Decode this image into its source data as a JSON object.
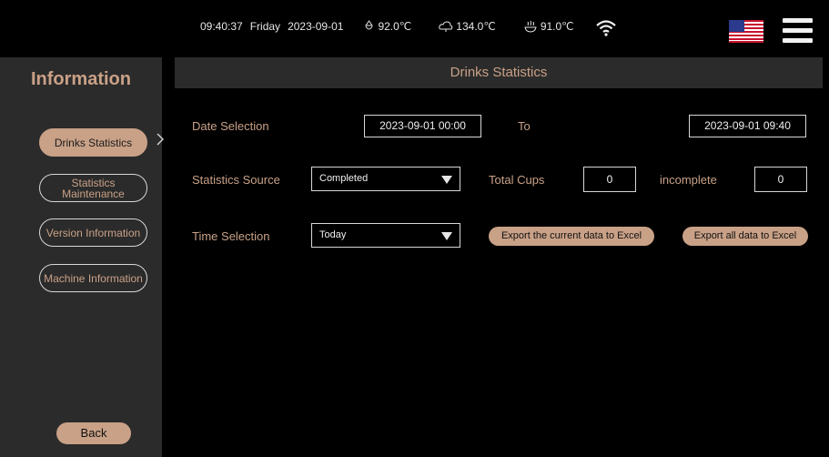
{
  "status_bar": {
    "time": "09:40:37",
    "weekday": "Friday",
    "date": "2023-09-01",
    "temps": [
      {
        "icon": "boiler-icon",
        "value": "92.0℃"
      },
      {
        "icon": "steam-icon",
        "value": "134.0℃"
      },
      {
        "icon": "cup-heater-icon",
        "value": "91.0℃"
      }
    ]
  },
  "sidebar": {
    "title": "Information",
    "items": [
      {
        "label": "Drinks Statistics",
        "active": true
      },
      {
        "label": "Statistics Maintenance",
        "active": false
      },
      {
        "label": "Version Information",
        "active": false
      },
      {
        "label": "Machine Information",
        "active": false
      }
    ],
    "back_label": "Back"
  },
  "main": {
    "header": "Drinks Statistics",
    "date_selection_label": "Date Selection",
    "date_from": "2023-09-01 00:00",
    "to_label": "To",
    "date_to": "2023-09-01 09:40",
    "statistics_source_label": "Statistics Source",
    "statistics_source_value": "Completed",
    "total_cups_label": "Total Cups",
    "total_cups_value": "0",
    "incomplete_label": "incomplete",
    "incomplete_value": "0",
    "time_selection_label": "Time Selection",
    "time_selection_value": "Today",
    "export_current_label": "Export the current data to Excel",
    "export_all_label": "Export all data to Excel"
  },
  "colors": {
    "accent": "#c9a187",
    "panel": "#2b2b2b",
    "background": "#000000"
  }
}
